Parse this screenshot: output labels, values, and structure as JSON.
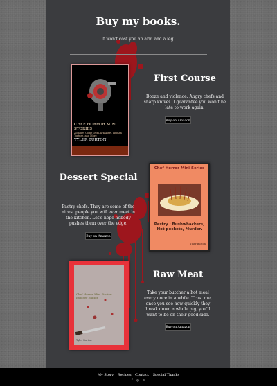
{
  "header": {
    "title": "Buy my books.",
    "subtitle": "It won't cost you an arm and a leg."
  },
  "books": [
    {
      "heading": "First Course",
      "description": "Booze and violence. Angry chefs and sharp knives. I guarantee you won't be late to work again.",
      "button_label": "Buy on Amazon",
      "cover": {
        "title": "CHEF HORROR MINI STORIES",
        "tagline": "Zombies Come Out Dark Alert, Human Torture, and More",
        "author": "TYLER BURTON",
        "background": "#000000"
      }
    },
    {
      "heading": "Dessert Special",
      "description": "Pastry chefs. They are some of the nicest people you will ever meet in the kitchen. Let's hope nobody pushes them over the edge.",
      "button_label": "Buy on Amazon",
      "cover": {
        "series": "Chef Horror Mini Series",
        "subtitle": "Pastry : Bushwhackers, Hot pockets, Murder.",
        "author": "Tyler Burton",
        "background": "#f08a63"
      }
    },
    {
      "heading": "Raw Meat",
      "description": "Take your butcher a hot meal every once in a while. Trust me, once you see how quickly they break down a whole pig, you'll want to be on their good side.",
      "button_label": "Buy on Amazon",
      "cover": {
        "title": "Chef Horror Mini Stories: Butcher Edition",
        "author": "Tyler Burton",
        "border": "#e8323a"
      }
    }
  ],
  "footer": {
    "nav": [
      "My Story",
      "Recipes",
      "Contact",
      "Special Thanks"
    ],
    "social": [
      "facebook-icon",
      "instagram-icon",
      "email-icon"
    ]
  },
  "colors": {
    "page_bg": "#6b6b6b",
    "panel_bg": "#3b3c3f",
    "blood": "#b0141a",
    "footer_bg": "#000000"
  }
}
